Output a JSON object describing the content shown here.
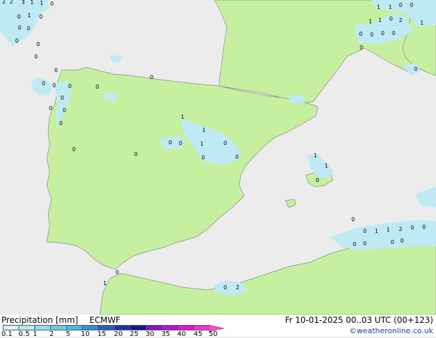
{
  "map": {
    "point_labels": [
      "2",
      "2",
      "3",
      "1",
      "1",
      "0",
      "0",
      "1",
      "0",
      "0",
      "0",
      "0",
      "0",
      "0",
      "0",
      "0",
      "0",
      "0",
      "0",
      "0",
      "0",
      "0",
      "0",
      "0",
      "1",
      "1",
      "0",
      "0",
      "1",
      "0",
      "0",
      "0",
      "0",
      "1",
      "1",
      "0",
      "0",
      "1",
      "0",
      "0",
      "2",
      "1",
      "1",
      "0",
      "2",
      "0",
      "0",
      "0",
      "0",
      "1",
      "1",
      "0",
      "0",
      "1",
      "0",
      "0",
      "0",
      "0",
      "1",
      "1",
      "2",
      "0",
      "0",
      "0",
      "0",
      "0",
      "0"
    ]
  },
  "legend": {
    "title": "Precipitation [mm]",
    "model": "ECMWF",
    "ticks": [
      "0.1",
      "0.5",
      "1",
      "2",
      "5",
      "10",
      "15",
      "20",
      "25",
      "30",
      "35",
      "40",
      "45",
      "50"
    ],
    "swatch_colors": [
      "#d8f5fb",
      "#b4eaf5",
      "#8fdcee",
      "#6ccce6",
      "#48b8de",
      "#3294d2",
      "#2460c2",
      "#1a34a8",
      "#14168c",
      "#8c10c8",
      "#b814d8",
      "#d81ad8",
      "#ea38d0"
    ],
    "arrow_color": "#f050c8",
    "valid_time": "Fr 10-01-2025 00..03 UTC (00+123)",
    "credit": "©weatheronline.co.uk"
  },
  "colors": {
    "sea": "#ececec",
    "land": "#c6f0a0",
    "precip_light": "#bfeaf4",
    "precip_mid": "#9ee0f0",
    "coast": "#888888"
  }
}
